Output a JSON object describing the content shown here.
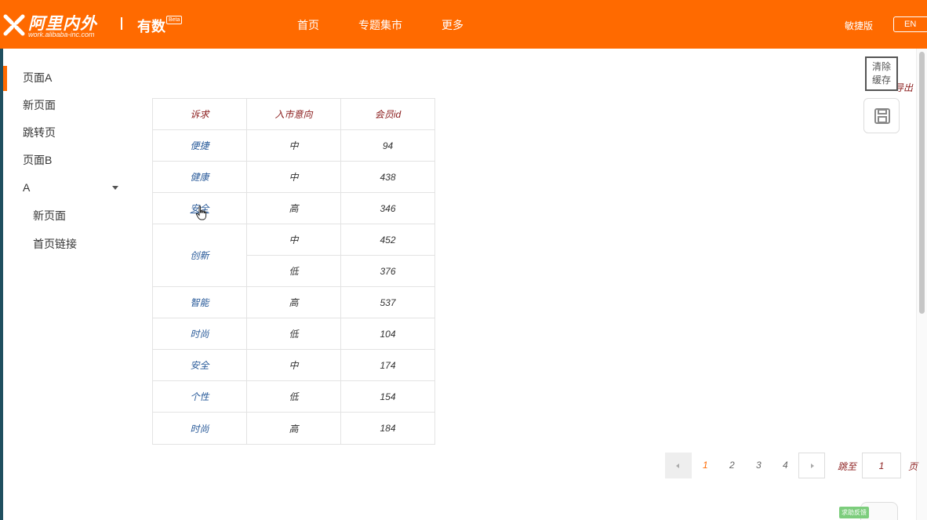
{
  "header": {
    "logo_main": "阿里内外",
    "logo_sub": "work.alibaba-inc.com",
    "product": "有数",
    "beta": "Beta",
    "nav": [
      {
        "label": "首页"
      },
      {
        "label": "专题集市"
      },
      {
        "label": "更多"
      }
    ],
    "edition": "敏捷版",
    "lang": "EN"
  },
  "sidebar": {
    "items": [
      {
        "label": "页面A"
      },
      {
        "label": "新页面"
      },
      {
        "label": "跳转页"
      },
      {
        "label": "页面B"
      },
      {
        "label": "A"
      }
    ],
    "children": [
      {
        "label": "新页面"
      },
      {
        "label": "首页链接"
      }
    ]
  },
  "table": {
    "headers": [
      "诉求",
      "入市意向",
      "会员id"
    ],
    "rows": [
      {
        "need": "便捷",
        "intent": "中",
        "id": "94"
      },
      {
        "need": "健康",
        "intent": "中",
        "id": "438"
      },
      {
        "need": "安全",
        "intent": "高",
        "id": "346"
      },
      {
        "need": "创新",
        "intent": "中",
        "id": "452"
      },
      {
        "need": "",
        "intent": "低",
        "id": "376"
      },
      {
        "need": "智能",
        "intent": "高",
        "id": "537"
      },
      {
        "need": "时尚",
        "intent": "低",
        "id": "104"
      },
      {
        "need": "安全",
        "intent": "中",
        "id": "174"
      },
      {
        "need": "个性",
        "intent": "低",
        "id": "154"
      },
      {
        "need": "时尚",
        "intent": "高",
        "id": "184"
      }
    ]
  },
  "tools": {
    "export": "导出",
    "clear_cache_line1": "清除",
    "clear_cache_line2": "缓存"
  },
  "pager": {
    "pages": [
      "1",
      "2",
      "3",
      "4"
    ],
    "current": "1",
    "jump_label": "跳至",
    "jump_value": "1",
    "unit": "页"
  },
  "feedback": {
    "label": "求助反馈"
  },
  "colors": {
    "brand": "#ff6a00",
    "header_text": "#8b1d1d",
    "link": "#2a5b9a"
  }
}
